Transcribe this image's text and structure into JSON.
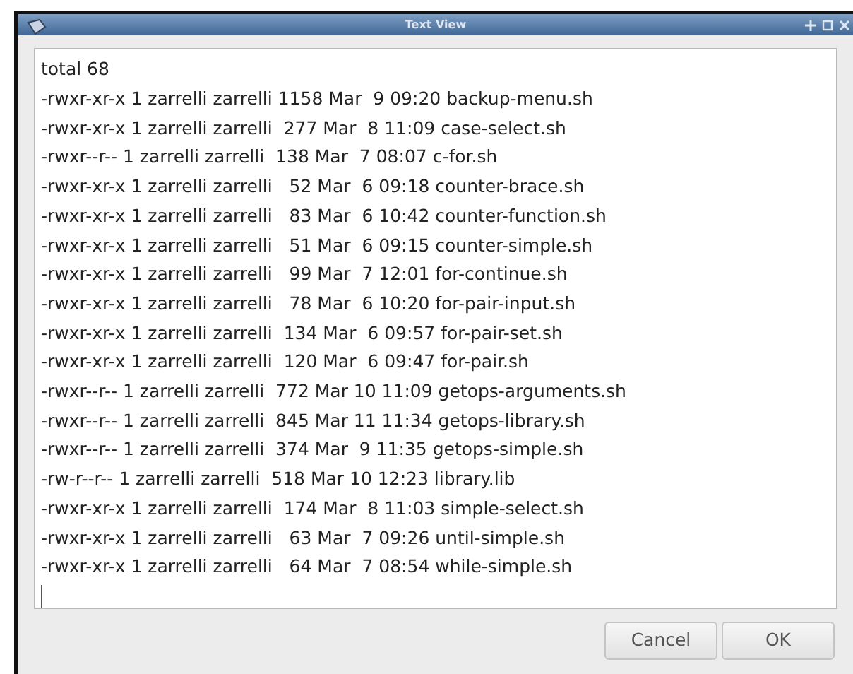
{
  "window": {
    "title": "Text View"
  },
  "text_lines": [
    "total 68",
    "-rwxr-xr-x 1 zarrelli zarrelli 1158 Mar  9 09:20 backup-menu.sh",
    "-rwxr-xr-x 1 zarrelli zarrelli  277 Mar  8 11:09 case-select.sh",
    "-rwxr--r-- 1 zarrelli zarrelli  138 Mar  7 08:07 c-for.sh",
    "-rwxr-xr-x 1 zarrelli zarrelli   52 Mar  6 09:18 counter-brace.sh",
    "-rwxr-xr-x 1 zarrelli zarrelli   83 Mar  6 10:42 counter-function.sh",
    "-rwxr-xr-x 1 zarrelli zarrelli   51 Mar  6 09:15 counter-simple.sh",
    "-rwxr-xr-x 1 zarrelli zarrelli   99 Mar  7 12:01 for-continue.sh",
    "-rwxr-xr-x 1 zarrelli zarrelli   78 Mar  6 10:20 for-pair-input.sh",
    "-rwxr-xr-x 1 zarrelli zarrelli  134 Mar  6 09:57 for-pair-set.sh",
    "-rwxr-xr-x 1 zarrelli zarrelli  120 Mar  6 09:47 for-pair.sh",
    "-rwxr--r-- 1 zarrelli zarrelli  772 Mar 10 11:09 getops-arguments.sh",
    "-rwxr--r-- 1 zarrelli zarrelli  845 Mar 11 11:34 getops-library.sh",
    "-rwxr--r-- 1 zarrelli zarrelli  374 Mar  9 11:35 getops-simple.sh",
    "-rw-r--r-- 1 zarrelli zarrelli  518 Mar 10 12:23 library.lib",
    "-rwxr-xr-x 1 zarrelli zarrelli  174 Mar  8 11:03 simple-select.sh",
    "-rwxr-xr-x 1 zarrelli zarrelli   63 Mar  7 09:26 until-simple.sh",
    "-rwxr-xr-x 1 zarrelli zarrelli   64 Mar  7 08:54 while-simple.sh"
  ],
  "buttons": [
    "Cancel",
    "OK"
  ]
}
